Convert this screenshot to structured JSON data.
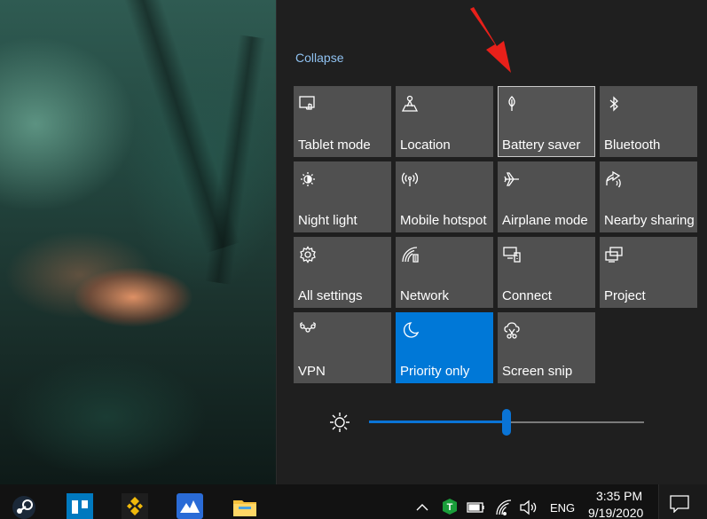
{
  "collapse_label": "Collapse",
  "tiles": [
    {
      "label": "Tablet mode",
      "icon": "tablet-mode-icon"
    },
    {
      "label": "Location",
      "icon": "location-icon"
    },
    {
      "label": "Battery saver",
      "icon": "battery-saver-icon"
    },
    {
      "label": "Bluetooth",
      "icon": "bluetooth-icon"
    },
    {
      "label": "Night light",
      "icon": "night-light-icon"
    },
    {
      "label": "Mobile hotspot",
      "icon": "mobile-hotspot-icon"
    },
    {
      "label": "Airplane mode",
      "icon": "airplane-icon"
    },
    {
      "label": "Nearby sharing",
      "icon": "nearby-sharing-icon"
    },
    {
      "label": "All settings",
      "icon": "gear-icon"
    },
    {
      "label": "Network",
      "icon": "network-icon"
    },
    {
      "label": "Connect",
      "icon": "connect-icon"
    },
    {
      "label": "Project",
      "icon": "project-icon"
    },
    {
      "label": "VPN",
      "icon": "vpn-icon"
    },
    {
      "label": "Priority only",
      "icon": "moon-icon",
      "active": true
    },
    {
      "label": "Screen snip",
      "icon": "screen-snip-icon"
    }
  ],
  "brightness": {
    "icon": "brightness-icon",
    "level_percent": 50
  },
  "taskbar": {
    "apps": [
      "steam-icon",
      "trello-icon",
      "binance-icon",
      "app-icon",
      "file-explorer-icon"
    ],
    "tray": {
      "language": "ENG",
      "time": "3:35 PM",
      "date": "9/19/2020"
    }
  },
  "colors": {
    "accent": "#0078d7",
    "tile": "#505050",
    "link": "#8fc1f0",
    "annotation": "#e8201a"
  }
}
